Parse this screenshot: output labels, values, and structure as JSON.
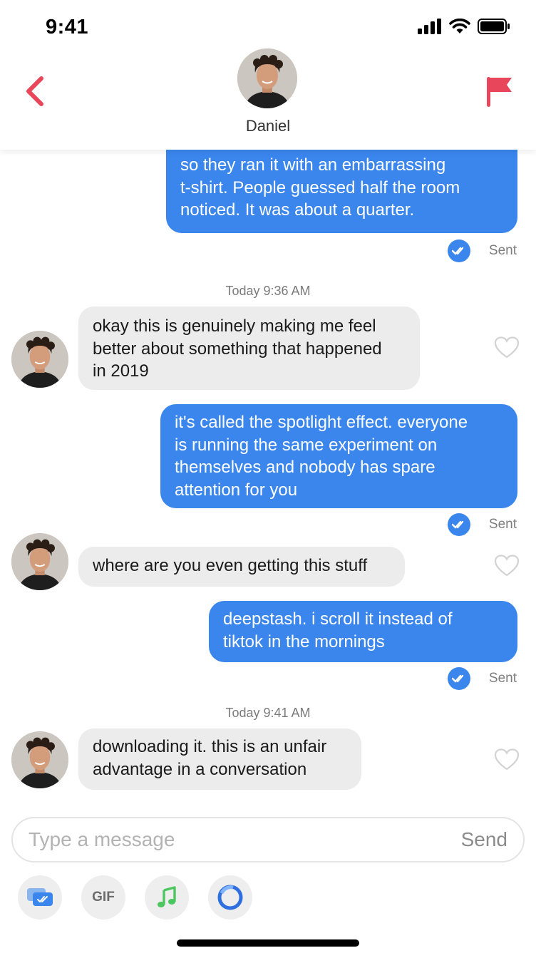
{
  "status_bar": {
    "time": "9:41"
  },
  "header": {
    "contact_name": "Daniel"
  },
  "messages": {
    "m1": {
      "lines": [
        "so they ran it with an embarrassing",
        "t-shirt. People guessed half the room",
        "noticed. It was about a quarter."
      ],
      "status": "Sent"
    },
    "ts1": "Today 9:36 AM",
    "m2": {
      "lines": [
        "okay this is genuinely making me feel",
        "better about something that happened",
        "in 2019"
      ]
    },
    "m3": {
      "lines": [
        "it's called the spotlight effect. everyone",
        "is running the same experiment on",
        "themselves and nobody has spare",
        "attention for you"
      ],
      "status": "Sent"
    },
    "m4": {
      "lines": [
        "where are you even getting this stuff"
      ]
    },
    "m5": {
      "lines": [
        "deepstash. i scroll it instead of",
        "tiktok in the mornings"
      ],
      "status": "Sent"
    },
    "ts2": "Today 9:41 AM",
    "m6": {
      "lines": [
        "downloading it. this is an unfair",
        "advantage in a conversation"
      ]
    }
  },
  "composer": {
    "placeholder": "Type a message",
    "send_label": "Send"
  },
  "toolbar": {
    "gif_label": "GIF"
  },
  "colors": {
    "accent": "#3a86ed",
    "brand_red": "#e8465a",
    "incoming_bubble": "#ececec"
  },
  "icons": {
    "back": "chevron-left-icon",
    "flag": "flag-icon",
    "heart": "heart-outline-icon",
    "check": "double-check-icon",
    "sticker": "chat-sticker-icon",
    "music": "music-note-icon",
    "circle": "ring-icon"
  }
}
